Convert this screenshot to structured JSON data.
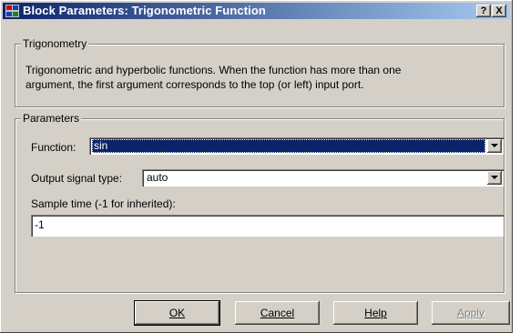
{
  "window": {
    "title": "Block Parameters: Trigonometric Function",
    "help_glyph": "?",
    "close_glyph": "X"
  },
  "trigonometry": {
    "legend": "Trigonometry",
    "description_line1": "Trigonometric and hyperbolic functions. When the function has more than one",
    "description_line2": "argument, the first argument corresponds to the top (or left) input port."
  },
  "parameters": {
    "legend": "Parameters",
    "function_label": "Function:",
    "function_value": "sin",
    "output_type_label": "Output signal type:",
    "output_type_value": "auto",
    "sample_time_label": "Sample time (-1 for inherited):",
    "sample_time_value": "-1"
  },
  "buttons": {
    "ok": "OK",
    "cancel": "Cancel",
    "help": "Help",
    "apply": "Apply"
  }
}
